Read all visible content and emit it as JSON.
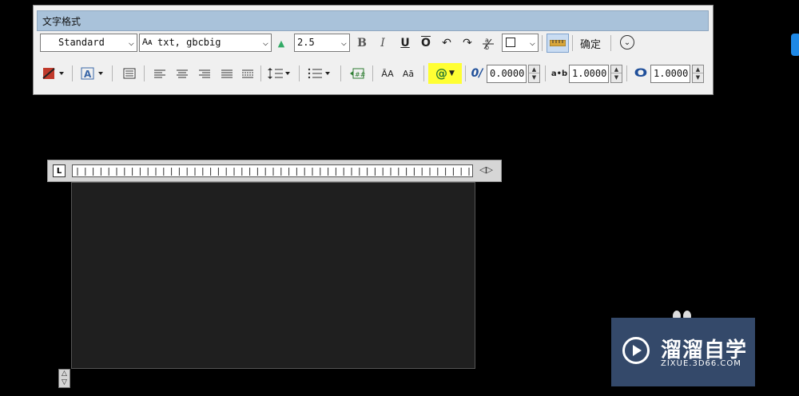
{
  "window": {
    "title": "文字格式"
  },
  "row1": {
    "style": "Standard",
    "font": "txt, gbcbig",
    "height": "2.5",
    "bold": "B",
    "italic": "I",
    "underline": "U",
    "overline": "O",
    "confirm": "确定"
  },
  "row2": {
    "lowercase": "ĀA",
    "uppercase": "Aā",
    "symbol": "@",
    "oblique_icon": "0/",
    "oblique": "0.0000",
    "tracking_icon": "a•b",
    "tracking": "1.0000",
    "width_icon": "O",
    "width": "1.0000"
  },
  "ruler": {
    "corner": "L",
    "arrows": "◁▷"
  },
  "watermark": {
    "name": "溜溜自学",
    "url": "ZIXUE.3D66.COM"
  },
  "colors": {
    "highlight": "#ffff33",
    "title_bar": "#a9c2da",
    "watermark_bg": "#34496a",
    "editor_bg": "#1f1f1f"
  }
}
